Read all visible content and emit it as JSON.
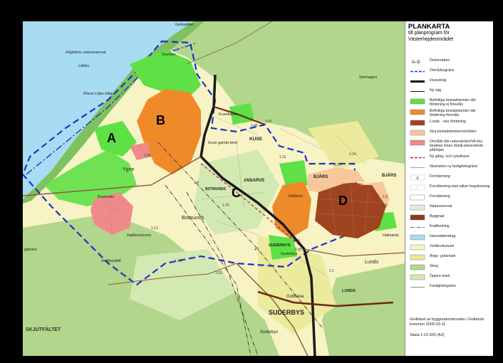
{
  "title": "PLANKARTA",
  "subtitle": "till planprogram för Västerhejdeområdet",
  "legend": [
    {
      "label": "Delområden",
      "sym": "letters",
      "sym_text": "A–D"
    },
    {
      "label": "Områdesgräns",
      "sym": "dash",
      "color": "#1c33c8"
    },
    {
      "label": "Huvudväg",
      "sym": "line",
      "color": "#111",
      "w": 3
    },
    {
      "label": "Ny väg",
      "sym": "line",
      "color": "#111",
      "w": 1
    },
    {
      "label": "Befintliga bostadstomter där förtätning ej föreslås",
      "sym": "box",
      "color": "#5fe046"
    },
    {
      "label": "Befintliga bostadstomter där förtätning föreslås",
      "sym": "box",
      "color": "#f08a28"
    },
    {
      "label": "Lunds - viss förtätning",
      "sym": "box",
      "color": "#a0441f"
    },
    {
      "label": "Nya bostadstomter/områden",
      "sym": "box",
      "color": "#f7c79a"
    },
    {
      "label": "Område där naturvärden/VA ska beaktas innan detalj-planearbete påbörjas",
      "sym": "box",
      "color": "#f08a8a"
    },
    {
      "label": "Ny gång- och cykelbana",
      "sym": "dash",
      "color": "#c1272d"
    },
    {
      "label": "Illustration ny fastighetsgräns",
      "sym": "line",
      "color": "#b58bd6",
      "w": 1
    },
    {
      "label": "Fornlämning",
      "sym": "mark",
      "color": "#c1272d"
    },
    {
      "label": "Fornlämning utan säker begränsning",
      "sym": "mark2",
      "color": "#c1272d"
    },
    {
      "label": "Fornlämning",
      "sym": "box",
      "color": "#ffffff"
    },
    {
      "label": "Naturreservat",
      "sym": "box",
      "color": "#e1efd6"
    },
    {
      "label": "Byggnad",
      "sym": "box",
      "color": "#8b3a1a"
    },
    {
      "label": "Kraftledning",
      "sym": "power",
      "color": "#333"
    },
    {
      "label": "Havsvattendrag",
      "sym": "box",
      "color": "#a8dcf2"
    },
    {
      "label": "Jordbruksmark",
      "sym": "box",
      "color": "#f7f3c5"
    },
    {
      "label": "Ängs- gräsmark",
      "sym": "box",
      "color": "#ecea9c"
    },
    {
      "label": "Skog",
      "sym": "box",
      "color": "#b2d68c"
    },
    {
      "label": "Öppen mark",
      "sym": "box",
      "color": "#d3e9b2"
    },
    {
      "label": "Fastighetsgräns",
      "sym": "line",
      "color": "#9a8a7a",
      "w": 1
    }
  ],
  "approval": "Godkänd av byggnadsnämnden i Gotlands kommun 2009-03-11",
  "scale": "Skala 1:10 000 (A3)",
  "areas": {
    "a": "A",
    "b": "B",
    "c": "C",
    "d": "D"
  },
  "places": {
    "getsvallen": "Getsvällen",
    "hogklints": "Högklints naturreservat",
    "storklev": "Storklev",
    "lilklev": "Lilklev",
    "rovar": "Rövar Liljas håla",
    "storhagen": "Storhagen",
    "kuse": "KUSE",
    "kuse_gamla": "Kuse gamla tomt",
    "ygne": "Ygne",
    "ansarve": "ANSARVE",
    "botmunds1": "BOTMUNDS",
    "botmunds2": "Botmunds",
    "hallbros": "Hallbros",
    "bjars1": "BJÄRS",
    "bjars2": "BJÄRS",
    "suderbys1": "SUDERBYS",
    "suderbys2": "SUDERBYS",
    "suderbys3": "Suderbys",
    "suderbys4": "Suderbys",
    "lunds1": "Lunds",
    "lunds2": "LUNDS",
    "hallvards": "Hallvards",
    "golfbana": "Golfbana",
    "skjutfaltet": "SKJUTFÄLTET",
    "hallbrosbrunn": "Hallbrosbrunn",
    "hallbrosloft": "Hallbroslöft",
    "bramolds": "Bramolds",
    "glanten": "glänten",
    "kusebacke": "Kusebacke"
  },
  "parcels": [
    "1:46",
    "1:47",
    "1:11",
    "1:4",
    "1:75",
    "1:13",
    "1:56",
    "1:14",
    "1:19",
    "2:1",
    "4:1",
    "1:10",
    "1:29",
    "1:3",
    "1:5",
    "3:11",
    "1:25"
  ],
  "colors": {
    "sea": "#a8dcf2",
    "forest": "#b2d68c",
    "open": "#d3e9b2",
    "field": "#f7f3c5",
    "meadow": "#ecea9c",
    "green": "#5fe046",
    "orange": "#f08a28",
    "brown": "#a0441f",
    "peach": "#f7c79a",
    "pink": "#f08a8a",
    "boundary": "#1c33c8",
    "road": "#1a1a1a"
  }
}
